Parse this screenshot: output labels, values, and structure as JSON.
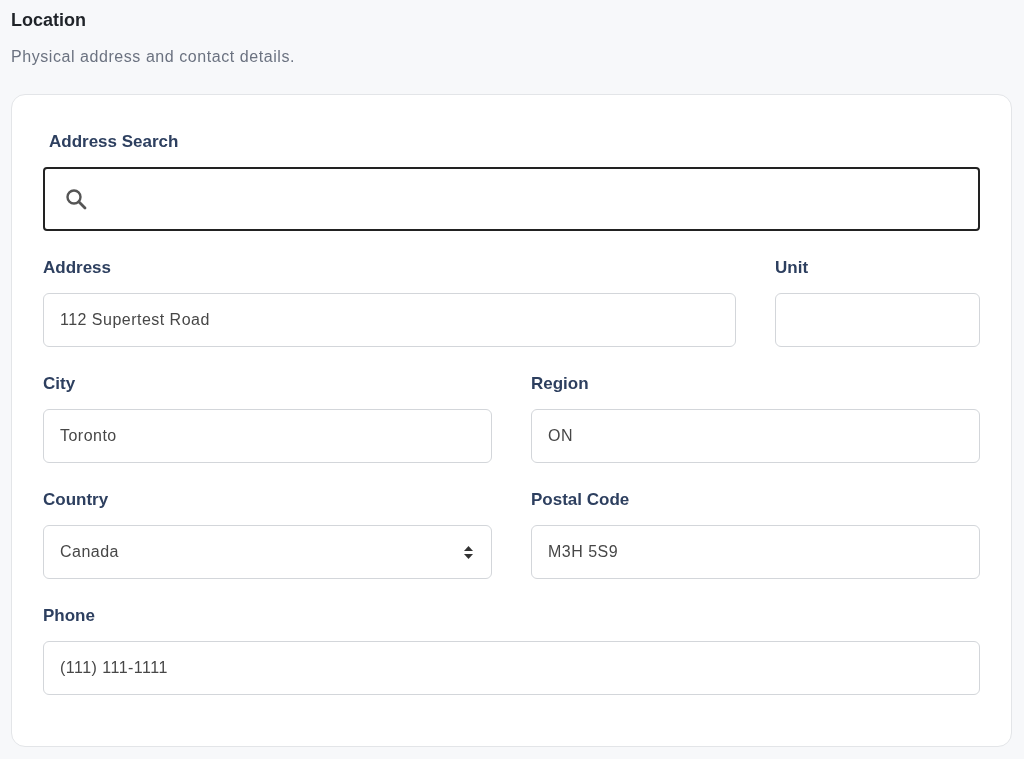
{
  "section": {
    "title": "Location",
    "subtitle": "Physical address and contact details."
  },
  "address_search": {
    "label": "Address Search"
  },
  "rows": [
    [
      {
        "label": "Address",
        "kind": "text",
        "value": "112 Supertest Road"
      },
      {
        "label": "Unit",
        "kind": "text"
      }
    ],
    [
      {
        "label": "City",
        "kind": "text",
        "value": "Toronto"
      },
      {
        "label": "Region",
        "kind": "text",
        "value": "ON"
      }
    ],
    [
      {
        "label": "Country",
        "kind": "select",
        "value": "Canada"
      },
      {
        "label": "Postal Code",
        "kind": "text",
        "value": "M3H 5S9"
      }
    ],
    [
      {
        "label": "Phone",
        "kind": "text",
        "value": "(111) 111-1111"
      }
    ]
  ]
}
